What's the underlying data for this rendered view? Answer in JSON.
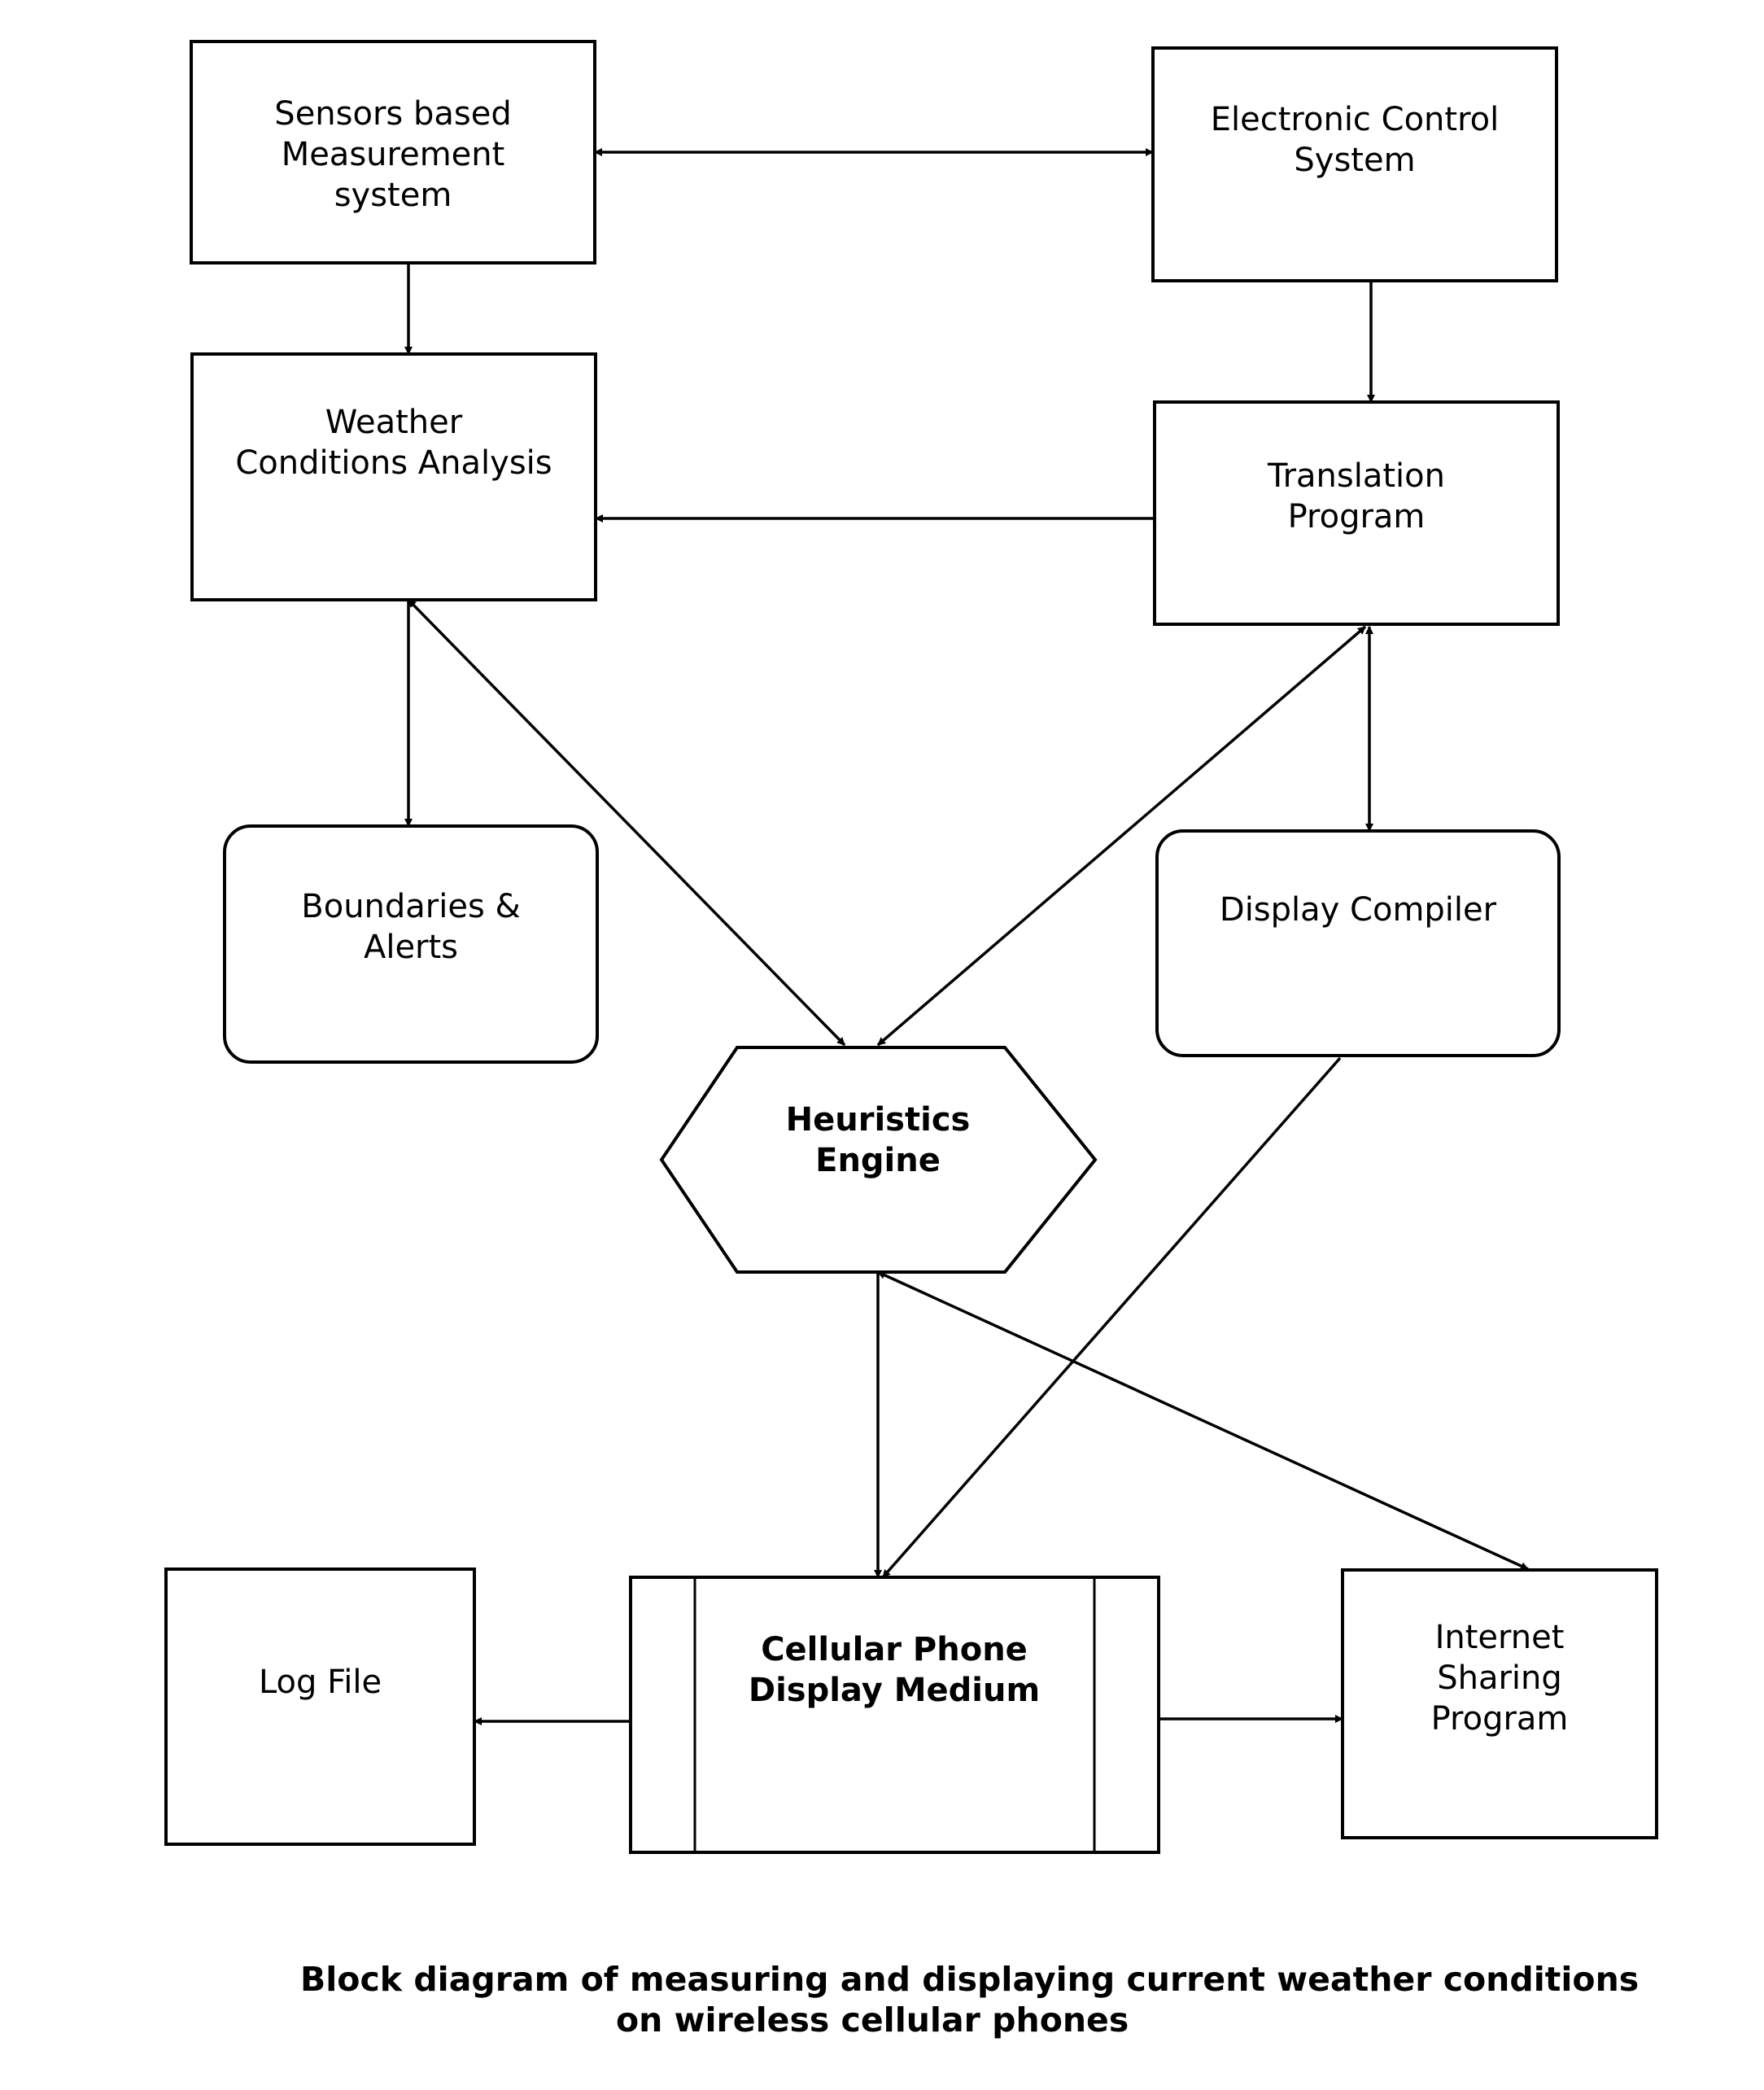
{
  "diagram": {
    "nodes": [
      {
        "id": "sensors",
        "shape": "rect",
        "bold": false,
        "lines": [
          "Sensors based",
          "Measurement",
          "system"
        ]
      },
      {
        "id": "electronic",
        "shape": "rect",
        "bold": false,
        "lines": [
          "Electronic Control",
          "System"
        ]
      },
      {
        "id": "weather",
        "shape": "rect",
        "bold": false,
        "lines": [
          "Weather",
          "Conditions Analysis"
        ]
      },
      {
        "id": "translation",
        "shape": "rect",
        "bold": false,
        "lines": [
          "Translation",
          "Program"
        ]
      },
      {
        "id": "boundaries",
        "shape": "rounded",
        "bold": false,
        "lines": [
          "Boundaries &",
          "Alerts"
        ]
      },
      {
        "id": "display-compiler",
        "shape": "rounded",
        "bold": false,
        "lines": [
          "Display Compiler"
        ]
      },
      {
        "id": "heuristics",
        "shape": "hexagon",
        "bold": true,
        "lines": [
          "Heuristics",
          "Engine"
        ]
      },
      {
        "id": "log-file",
        "shape": "rect",
        "bold": false,
        "lines": [
          "Log File"
        ]
      },
      {
        "id": "cellular",
        "shape": "process",
        "bold": true,
        "lines": [
          "Cellular Phone",
          "Display Medium"
        ]
      },
      {
        "id": "internet",
        "shape": "rect",
        "bold": false,
        "lines": [
          "Internet",
          "Sharing",
          "Program"
        ]
      }
    ],
    "edges": [
      {
        "from": "sensors",
        "to": "electronic",
        "direction": "both"
      },
      {
        "from": "sensors",
        "to": "weather",
        "direction": "forward"
      },
      {
        "from": "electronic",
        "to": "translation",
        "direction": "forward"
      },
      {
        "from": "translation",
        "to": "weather",
        "direction": "forward"
      },
      {
        "from": "weather",
        "to": "heuristics",
        "direction": "both"
      },
      {
        "from": "weather",
        "to": "boundaries",
        "direction": "forward"
      },
      {
        "from": "translation",
        "to": "heuristics",
        "direction": "both"
      },
      {
        "from": "translation",
        "to": "display-compiler",
        "direction": "both"
      },
      {
        "from": "display-compiler",
        "to": "cellular",
        "direction": "forward"
      },
      {
        "from": "heuristics",
        "to": "cellular",
        "direction": "forward"
      },
      {
        "from": "heuristics",
        "to": "internet",
        "direction": "both"
      },
      {
        "from": "cellular",
        "to": "log-file",
        "direction": "forward"
      },
      {
        "from": "cellular",
        "to": "internet",
        "direction": "forward"
      }
    ],
    "caption": {
      "line1": "Block diagram of measuring and displaying current weather conditions",
      "line2": "on wireless cellular phones"
    }
  }
}
